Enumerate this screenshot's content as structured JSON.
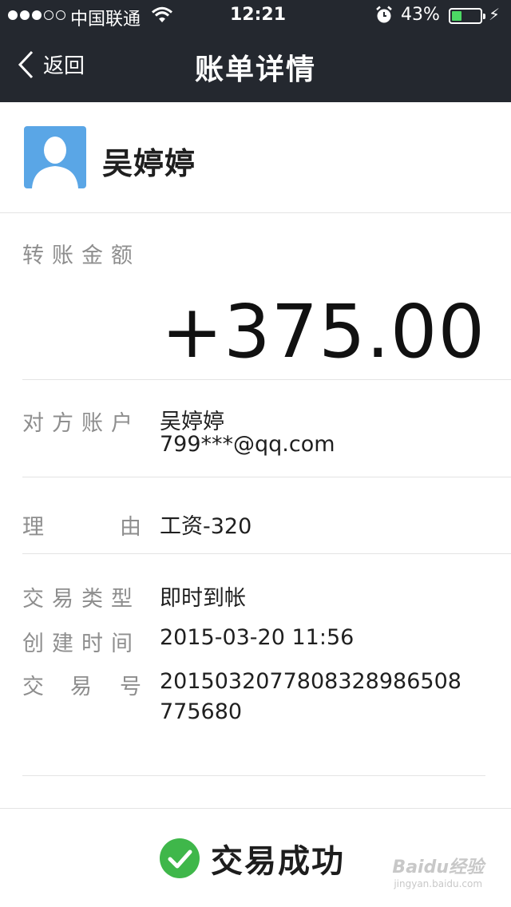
{
  "status_bar": {
    "carrier": "中国联通",
    "time": "12:21",
    "battery_percent": "43%",
    "battery_level": 0.43,
    "signal_bars_filled": 3,
    "signal_bars_total": 5
  },
  "nav": {
    "back_label": "返回",
    "title": "账单详情"
  },
  "user": {
    "name": "吴婷婷"
  },
  "transfer": {
    "amount_label": "转账金额",
    "amount": "+375.00"
  },
  "details": {
    "account_label": "对方账户",
    "account_name": "吴婷婷",
    "account_email": "799***@qq.com",
    "reason_label_1": "理",
    "reason_label_2": "由",
    "reason": "工资-320",
    "type_label": "交易类型",
    "type": "即时到帐",
    "created_label": "创建时间",
    "created": "2015-03-20  11:56",
    "txn_label_1": "交",
    "txn_label_2": "易",
    "txn_label_3": "号",
    "txn_line1": "2015032077808328986508",
    "txn_line2": "775680"
  },
  "result": {
    "status": "交易成功"
  },
  "watermark": {
    "brand": "Baidu经验",
    "url": "jingyan.baidu.com"
  },
  "colors": {
    "nav_bg": "#24282f",
    "avatar_bg": "#5aa6e6",
    "success_green": "#3fb74a",
    "battery_green": "#4cd964"
  }
}
